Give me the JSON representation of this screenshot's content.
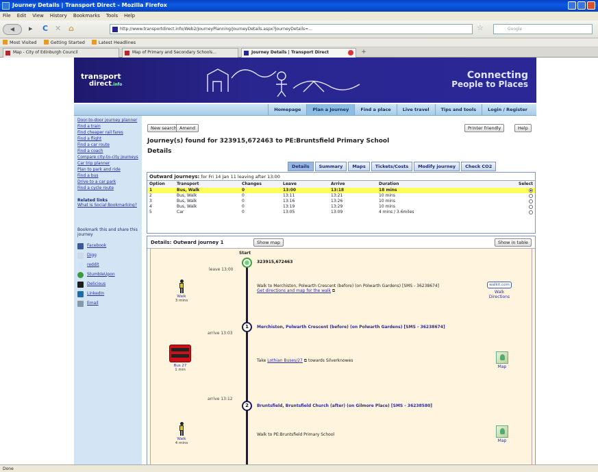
{
  "browser": {
    "title": "Journey Details | Transport Direct - Mozilla Firefox",
    "menu": [
      "File",
      "Edit",
      "View",
      "History",
      "Bookmarks",
      "Tools",
      "Help"
    ],
    "url": "http://www.transportdirect.info/Web2/JourneyPlanning/JourneyDetails.aspx?JourneyDetails=...",
    "search_placeholder": "Google",
    "bookmarks": [
      "Most Visited",
      "Getting Started",
      "Latest Headlines"
    ],
    "tabs": [
      "Map - City of Edinburgh Council",
      "Map of Primary and Secondary Schools...",
      "Journey Details | Transport Direct"
    ],
    "status": "Done"
  },
  "site": {
    "logo_line1": "transport",
    "logo_line2": "direct",
    "logo_suffix": ".info",
    "slogan_line1": "Connecting",
    "slogan_line2": "People to Places",
    "nav": [
      "Homepage",
      "Plan a Journey",
      "Find a place",
      "Live travel",
      "Tips and tools",
      "Login / Register"
    ]
  },
  "sidebar": {
    "links": [
      "Door-to-door journey planner",
      "Find a train",
      "Find cheaper rail fares",
      "Find a flight",
      "Find a car route",
      "Find a coach",
      "Compare city-to-city journeys",
      "Car trip planner",
      "Plan to park and ride",
      "Find a bus",
      "Drive to a car park",
      "Find a cycle route"
    ],
    "related_title": "Related links",
    "related_links": [
      "What is Social Bookmarking?"
    ],
    "bookmark_title": "Bookmark this and share this journey",
    "share": [
      {
        "label": "Facebook",
        "color": "#3b5998"
      },
      {
        "label": "Digg",
        "color": "#cfd8e8"
      },
      {
        "label": "reddit",
        "color": "#cee3f8"
      },
      {
        "label": "StumbleUpon",
        "color": "#3c9b3c"
      },
      {
        "label": "Delicious",
        "color": "#1d1d1d"
      },
      {
        "label": "LinkedIn",
        "color": "#1d6ea8"
      },
      {
        "label": "Email",
        "color": "#8899aa"
      }
    ]
  },
  "main": {
    "new_search": "New search",
    "amend": "Amend",
    "printer_friendly": "Printer friendly",
    "help": "Help",
    "heading": "Journey(s) found for 323915,672463 to PE:Bruntsfield Primary School",
    "heading2": "Details",
    "result_tabs": [
      "Details",
      "Summary",
      "Maps",
      "Tickets/Costs",
      "Modify journey",
      "Check CO2"
    ],
    "outward_title": "Outward journeys:",
    "outward_subtitle": "for Fri 14 Jan 11 leaving after 13:00",
    "columns": [
      "Option",
      "Transport",
      "Changes",
      "Leave",
      "Arrive",
      "Duration",
      "Select"
    ],
    "rows": [
      {
        "option": "1",
        "transport": "Bus, Walk",
        "changes": "0",
        "leave": "13:00",
        "arrive": "13:18",
        "duration": "18 mins",
        "selected": true
      },
      {
        "option": "2",
        "transport": "Bus, Walk",
        "changes": "0",
        "leave": "13:11",
        "arrive": "13:21",
        "duration": "10 mins",
        "selected": false
      },
      {
        "option": "3",
        "transport": "Bus, Walk",
        "changes": "0",
        "leave": "13:16",
        "arrive": "13:26",
        "duration": "10 mins",
        "selected": false
      },
      {
        "option": "4",
        "transport": "Bus, Walk",
        "changes": "0",
        "leave": "13:19",
        "arrive": "13:29",
        "duration": "10 mins",
        "selected": false
      },
      {
        "option": "5",
        "transport": "Car",
        "changes": "0",
        "leave": "13:05",
        "arrive": "13:09",
        "duration": "4 mins / 3.6miles",
        "selected": false
      }
    ],
    "details_title": "Details: Outward journey 1",
    "show_map": "Show map",
    "show_table": "Show in table",
    "timeline": {
      "start_label": "Start",
      "origin": "323915,672463",
      "leave1": "leave 13:00",
      "walk1_mode": "Walk",
      "walk1_time": "3 mins",
      "walk1_text": "Walk to Merchiston, Polwarth Crescent (before) (on Polwarth Gardens) [SMS - 36238674]",
      "walk1_link": "Get directions and map for the walk",
      "walkit_label": "walkit.com",
      "walkit_link": "Walk Directions",
      "arrive1": "arrive 13:03",
      "stop1": "Merchiston, Polwarth Crescent (before) (on Polwarth Gardens) [SMS - 36238674]",
      "bus_mode": "Bus 27",
      "bus_time": "1 min",
      "bus_text_pre": "Take",
      "bus_link": "Lothian Buses/27",
      "bus_text_post": "towards Silverknowes",
      "map_label": "Map",
      "leave2": "arrive 13:12",
      "stop2": "Bruntsfield, Bruntsfield Church (after) (on Gilmore Place) [SMS - 36238580]",
      "walk2_mode": "Walk",
      "walk2_time": "4 mins",
      "walk2_text": "Walk to PE:Bruntsfield Primary School"
    }
  }
}
